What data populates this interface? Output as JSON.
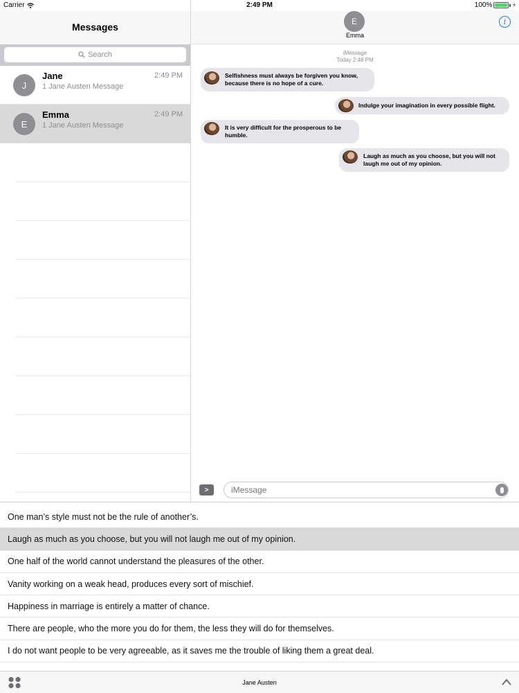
{
  "status_bar": {
    "carrier": "Carrier",
    "time": "2:49 PM",
    "battery": "100%"
  },
  "sidebar": {
    "title": "Messages",
    "search_placeholder": "Search",
    "conversations": [
      {
        "avatar": "J",
        "name": "Jane",
        "time": "2:49 PM",
        "preview": "1 Jane Austen Message",
        "selected": false
      },
      {
        "avatar": "E",
        "name": "Emma",
        "time": "2:49 PM",
        "preview": "1 Jane Austen Message",
        "selected": true
      }
    ]
  },
  "thread": {
    "contact_initial": "E",
    "contact_name": "Emma",
    "service": "iMessage",
    "timestamp": "Today 2:48 PM",
    "messages": [
      {
        "direction": "incoming",
        "text": "Selfishness must always be forgiven you know, because there is no hope of a cure."
      },
      {
        "direction": "outgoing",
        "text": "Indulge your imagination in every possible flight."
      },
      {
        "direction": "incoming",
        "text": "It is very difficult for the prosperous to be humble."
      },
      {
        "direction": "outgoing",
        "text": "Laugh as much as you choose, but you will not laugh me out of my opinion."
      }
    ],
    "composer_placeholder": "iMessage",
    "expand_icon": "chevron-right-icon",
    "mic_icon": "microphone-icon",
    "info_icon": "info-icon"
  },
  "quotes": {
    "selected_index": 1,
    "items": [
      "One man’s style must not be the rule of another’s.",
      "Laugh as much as you choose, but you will not laugh me out of my opinion.",
      "One half of the world cannot understand the pleasures of the other.",
      "Vanity working on a weak head, produces every sort of mischief.",
      "Happiness in marriage is entirely a matter of chance.",
      "There are people, who the more you do for them, the less they will do for themselves.",
      "I do not want people to be very agreeable, as it saves me the trouble of liking them a great deal."
    ]
  },
  "toolbar": {
    "title": "Jane Austen",
    "apps_icon": "app-drawer-icon",
    "collapse_icon": "chevron-up-icon"
  },
  "colors": {
    "accent": "#1a7cf5",
    "bubble": "#e5e5ea",
    "selected_row": "#d9d9d9",
    "avatar_gray": "#8e8e93"
  }
}
